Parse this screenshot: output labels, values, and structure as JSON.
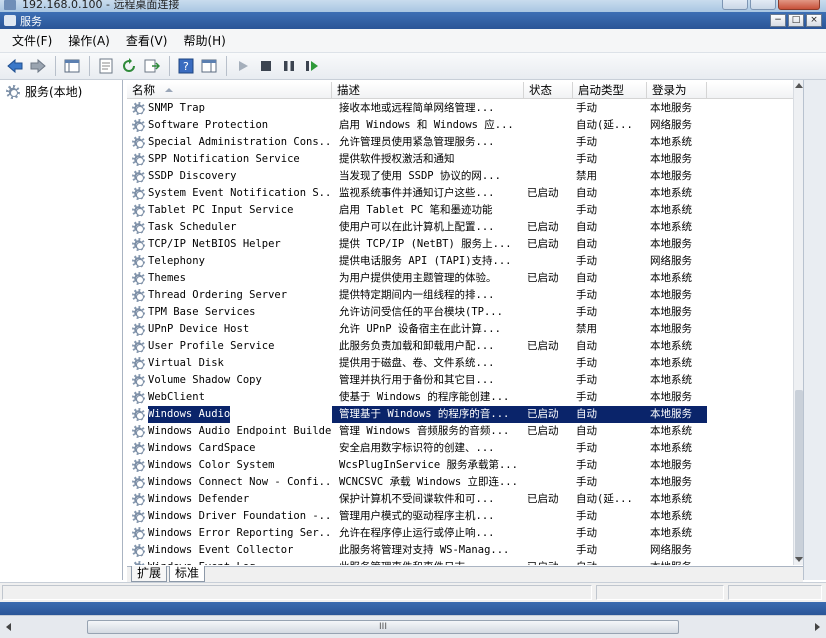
{
  "rdp": {
    "title": "192.168.0.100 - 远程桌面连接"
  },
  "window": {
    "title": "服务"
  },
  "menu": [
    "文件(F)",
    "操作(A)",
    "查看(V)",
    "帮助(H)"
  ],
  "tree": {
    "root_label": "服务(本地)"
  },
  "columns": {
    "name": "名称",
    "desc": "描述",
    "state": "状态",
    "start": "启动类型",
    "logon": "登录为"
  },
  "services": [
    {
      "name": "SNMP Trap",
      "desc": "接收本地或远程简单网络管理...",
      "state": "",
      "start": "手动",
      "logon": "本地服务"
    },
    {
      "name": "Software Protection",
      "desc": "启用 Windows 和 Windows 应...",
      "state": "",
      "start": "自动(延...",
      "logon": "网络服务"
    },
    {
      "name": "Special Administration Cons...",
      "desc": "允许管理员使用紧急管理服务...",
      "state": "",
      "start": "手动",
      "logon": "本地系统"
    },
    {
      "name": "SPP Notification Service",
      "desc": "提供软件授权激活和通知",
      "state": "",
      "start": "手动",
      "logon": "本地服务"
    },
    {
      "name": "SSDP Discovery",
      "desc": "当发现了使用 SSDP 协议的网...",
      "state": "",
      "start": "禁用",
      "logon": "本地服务"
    },
    {
      "name": "System Event Notification S...",
      "desc": "监视系统事件并通知订户这些...",
      "state": "已启动",
      "start": "自动",
      "logon": "本地系统"
    },
    {
      "name": "Tablet PC Input Service",
      "desc": "启用 Tablet PC 笔和墨迹功能",
      "state": "",
      "start": "手动",
      "logon": "本地系统"
    },
    {
      "name": "Task Scheduler",
      "desc": "使用户可以在此计算机上配置...",
      "state": "已启动",
      "start": "自动",
      "logon": "本地系统"
    },
    {
      "name": "TCP/IP NetBIOS Helper",
      "desc": "提供 TCP/IP (NetBT) 服务上...",
      "state": "已启动",
      "start": "自动",
      "logon": "本地服务"
    },
    {
      "name": "Telephony",
      "desc": "提供电话服务 API (TAPI)支持...",
      "state": "",
      "start": "手动",
      "logon": "网络服务"
    },
    {
      "name": "Themes",
      "desc": "为用户提供使用主题管理的体验。",
      "state": "已启动",
      "start": "自动",
      "logon": "本地系统"
    },
    {
      "name": "Thread Ordering Server",
      "desc": "提供特定期间内一组线程的排...",
      "state": "",
      "start": "手动",
      "logon": "本地服务"
    },
    {
      "name": "TPM Base Services",
      "desc": "允许访问受信任的平台模块(TP...",
      "state": "",
      "start": "手动",
      "logon": "本地服务"
    },
    {
      "name": "UPnP Device Host",
      "desc": "允许 UPnP 设备宿主在此计算...",
      "state": "",
      "start": "禁用",
      "logon": "本地服务"
    },
    {
      "name": "User Profile Service",
      "desc": "此服务负责加载和卸载用户配...",
      "state": "已启动",
      "start": "自动",
      "logon": "本地系统"
    },
    {
      "name": "Virtual Disk",
      "desc": "提供用于磁盘、卷、文件系统...",
      "state": "",
      "start": "手动",
      "logon": "本地系统"
    },
    {
      "name": "Volume Shadow Copy",
      "desc": "管理并执行用于备份和其它目...",
      "state": "",
      "start": "手动",
      "logon": "本地系统"
    },
    {
      "name": "WebClient",
      "desc": "使基于 Windows 的程序能创建...",
      "state": "",
      "start": "手动",
      "logon": "本地服务"
    },
    {
      "name": "Windows Audio",
      "desc": "管理基于 Windows 的程序的音...",
      "state": "已启动",
      "start": "自动",
      "logon": "本地服务",
      "selected": true
    },
    {
      "name": "Windows Audio Endpoint Builder",
      "desc": "管理 Windows 音频服务的音频...",
      "state": "已启动",
      "start": "自动",
      "logon": "本地系统"
    },
    {
      "name": "Windows CardSpace",
      "desc": "安全启用数字标识符的创建、...",
      "state": "",
      "start": "手动",
      "logon": "本地系统"
    },
    {
      "name": "Windows Color System",
      "desc": "WcsPlugInService 服务承载第...",
      "state": "",
      "start": "手动",
      "logon": "本地服务"
    },
    {
      "name": "Windows Connect Now - Confi...",
      "desc": "WCNCSVC 承载 Windows 立即连...",
      "state": "",
      "start": "手动",
      "logon": "本地服务"
    },
    {
      "name": "Windows Defender",
      "desc": "保护计算机不受间谍软件和可...",
      "state": "已启动",
      "start": "自动(延...",
      "logon": "本地系统"
    },
    {
      "name": "Windows Driver Foundation -...",
      "desc": "管理用户模式的驱动程序主机...",
      "state": "",
      "start": "手动",
      "logon": "本地系统"
    },
    {
      "name": "Windows Error Reporting Ser...",
      "desc": "允许在程序停止运行或停止响...",
      "state": "",
      "start": "手动",
      "logon": "本地系统"
    },
    {
      "name": "Windows Event Collector",
      "desc": "此服务将管理对支持 WS-Manag...",
      "state": "",
      "start": "手动",
      "logon": "网络服务"
    },
    {
      "name": "Windows Event Log",
      "desc": "此服务管理事件和事件日志...",
      "state": "已启动",
      "start": "自动",
      "logon": "本地服务"
    }
  ],
  "tabs": {
    "extended": "扩展",
    "standard": "标准"
  },
  "hscroll": {
    "grip": "III"
  },
  "colors": {
    "selection": "#0a246a",
    "caption": "#2a5597"
  }
}
